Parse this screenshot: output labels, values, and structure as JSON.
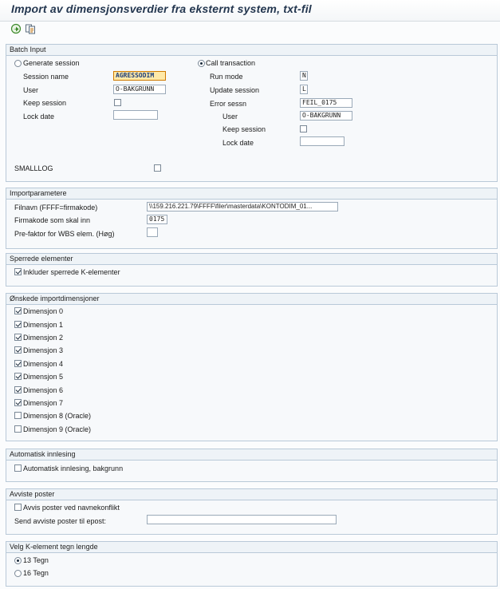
{
  "title": "Import av dimensjonsverdier fra eksternt system, txt-fil",
  "toolbar": {
    "icons": [
      "execute-icon",
      "variant-icon"
    ]
  },
  "batch_input": {
    "header": "Batch Input",
    "generate_session": {
      "label": "Generate session",
      "selected": false
    },
    "session_name": {
      "label": "Session name",
      "value": "AGRESSODIM"
    },
    "user": {
      "label": "User",
      "value": "O-BAKGRUNN"
    },
    "keep_session": {
      "label": "Keep session",
      "checked": false
    },
    "lock_date": {
      "label": "Lock date",
      "value": ""
    },
    "call_transaction": {
      "label": "Call transaction",
      "selected": true
    },
    "run_mode": {
      "label": "Run mode",
      "value": "N"
    },
    "update_session": {
      "label": "Update session",
      "value": "L"
    },
    "error_sessn": {
      "label": "Error sessn",
      "value": "FEIL_0175"
    },
    "user2": {
      "label": "User",
      "value": "O-BAKGRUNN"
    },
    "keep_session2": {
      "label": "Keep session",
      "checked": false
    },
    "lock_date2": {
      "label": "Lock date",
      "value": ""
    },
    "smalllog": {
      "label": "SMALLLOG",
      "checked": false
    }
  },
  "importparametere": {
    "header": "Importparametere",
    "filnavn": {
      "label": "Filnavn (FFFF=firmakode)",
      "value": "\\\\159.216.221.79\\FFFF\\filer\\masterdata\\KONTODIM_01..."
    },
    "firmakode": {
      "label": "Firmakode som skal inn",
      "value": "0175"
    },
    "prefaktor": {
      "label": "Pre-faktor for WBS elem. (Høg)",
      "value": ""
    }
  },
  "sperrede": {
    "header": "Sperrede elementer",
    "inkluder": {
      "label": "Inkluder sperrede K-elementer",
      "checked": true
    }
  },
  "onskede": {
    "header": "Ønskede importdimensjoner",
    "items": [
      {
        "label": "Dimensjon 0",
        "checked": true
      },
      {
        "label": "Dimensjon 1",
        "checked": true
      },
      {
        "label": "Dimensjon 2",
        "checked": true
      },
      {
        "label": "Dimensjon 3",
        "checked": true
      },
      {
        "label": "Dimensjon 4",
        "checked": true
      },
      {
        "label": "Dimensjon 5",
        "checked": true
      },
      {
        "label": "Dimensjon 6",
        "checked": true
      },
      {
        "label": "Dimensjon 7",
        "checked": true
      },
      {
        "label": "Dimensjon 8 (Oracle)",
        "checked": false
      },
      {
        "label": "Dimensjon 9 (Oracle)",
        "checked": false
      }
    ]
  },
  "automatisk": {
    "header": "Automatisk innlesing",
    "bakgrunn": {
      "label": "Automatisk innlesing, bakgrunn",
      "checked": false
    }
  },
  "avviste": {
    "header": "Avviste poster",
    "avvis": {
      "label": "Avvis poster ved navnekonflikt",
      "checked": false
    },
    "epost": {
      "label": "Send avviste poster til epost:",
      "value": ""
    }
  },
  "velg": {
    "header": "Velg K-element tegn lengde",
    "options": [
      {
        "label": "13 Tegn",
        "selected": true
      },
      {
        "label": "16 Tegn",
        "selected": false
      }
    ]
  }
}
